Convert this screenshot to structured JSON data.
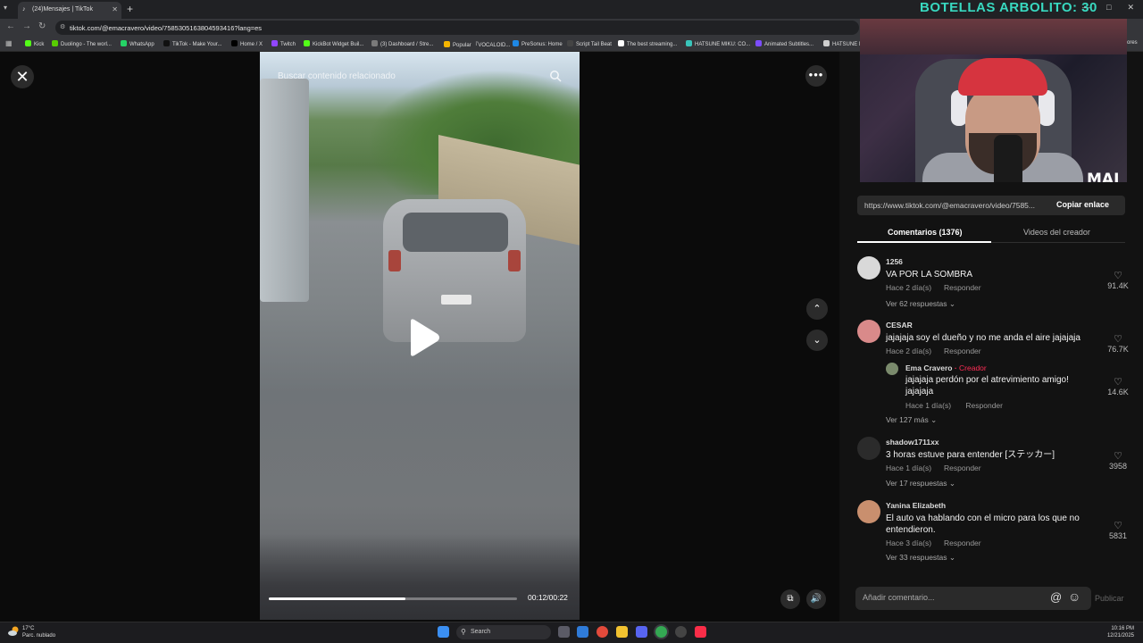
{
  "browser": {
    "tab_title": "(24)Mensajes | TikTok",
    "new_tab_symbol": "+",
    "url": "tiktok.com/@emacravero/video/7585305163804593416?lang=es",
    "bookmarks": [
      {
        "label": "Kick",
        "color": "#53fc18"
      },
      {
        "label": "Duolingo - The worl...",
        "color": "#58cc02"
      },
      {
        "label": "WhatsApp",
        "color": "#25d366"
      },
      {
        "label": "TikTok - Make Your...",
        "color": "#111111"
      },
      {
        "label": "Home / X",
        "color": "#000000"
      },
      {
        "label": "Twitch",
        "color": "#9146ff"
      },
      {
        "label": "KickBot Widget Buil...",
        "color": "#53fc18"
      },
      {
        "label": "(3) Dashboard / Stre...",
        "color": "#7a7a7a"
      },
      {
        "label": "Popular 『VOCALOID...",
        "color": "#f4b400"
      },
      {
        "label": "PreSonus: Home",
        "color": "#1e88e5"
      },
      {
        "label": "Script Tail Beat",
        "color": "#444444"
      },
      {
        "label": "The best streaming...",
        "color": "#ffffff"
      },
      {
        "label": "HATSUNE MIKU: CO...",
        "color": "#39c5bb"
      },
      {
        "label": "Animated Subtitles...",
        "color": "#7c4dff"
      },
      {
        "label": "HATSUNE M",
        "color": "#cfcfcf"
      }
    ],
    "bookmarks_more": "ores"
  },
  "overlay": {
    "title": "BOTELLAS ARBOLITO: 30",
    "logo_text": "MAI"
  },
  "video": {
    "search_placeholder": "Buscar contenido relacionado",
    "time": "00:12/00:22",
    "progress": 0.55
  },
  "panel": {
    "link_url": "https://www.tiktok.com/@emacravero/video/7585...",
    "copy_label": "Copiar enlace",
    "tab_comments": "Comentarios (1376)",
    "tab_creator_videos": "Videos del creador",
    "comment_placeholder": "Añadir comentario...",
    "publish_label": "Publicar",
    "comments": [
      {
        "user": "1256",
        "text": "VA POR LA SOMBRA",
        "time": "Hace 2 día(s)",
        "reply": "Responder",
        "likes": "91.4K",
        "replies": "Ver 62 respuestas",
        "avatar_color": "#d9d9d9"
      },
      {
        "user": "CESAR",
        "text": "jajajaja soy el dueño y no me anda el aire jajajaja",
        "time": "Hace 2 día(s)",
        "reply": "Responder",
        "likes": "76.7K",
        "replies": "Ver 127 más",
        "avatar_color": "#d98a8a"
      },
      {
        "user": "shadow1711xx",
        "text": "3 horas estuve para entender [ステッカー]",
        "time": "Hace 1 día(s)",
        "reply": "Responder",
        "likes": "3958",
        "replies": "Ver 17 respuestas",
        "avatar_color": "#2b2b2b"
      },
      {
        "user": "Yanina Elizabeth",
        "text": "El auto va hablando con el micro para los que no entendieron.",
        "time": "Hace 3 día(s)",
        "reply": "Responder",
        "likes": "5831",
        "replies": "Ver 33 respuestas",
        "avatar_color": "#c98f6e"
      }
    ],
    "creator_reply": {
      "user": "Ema Cravero",
      "separator": " · ",
      "tag": "Creador",
      "text": "jajajaja perdón por el atrevimiento amigo! jajajaja",
      "time": "Hace 1 día(s)",
      "reply": "Responder",
      "likes": "14.6K"
    }
  },
  "taskbar": {
    "temp": "17°C",
    "weather": "Parc. nublado",
    "search": "Search",
    "time": "10:16 PM",
    "date": "12/21/2025"
  }
}
